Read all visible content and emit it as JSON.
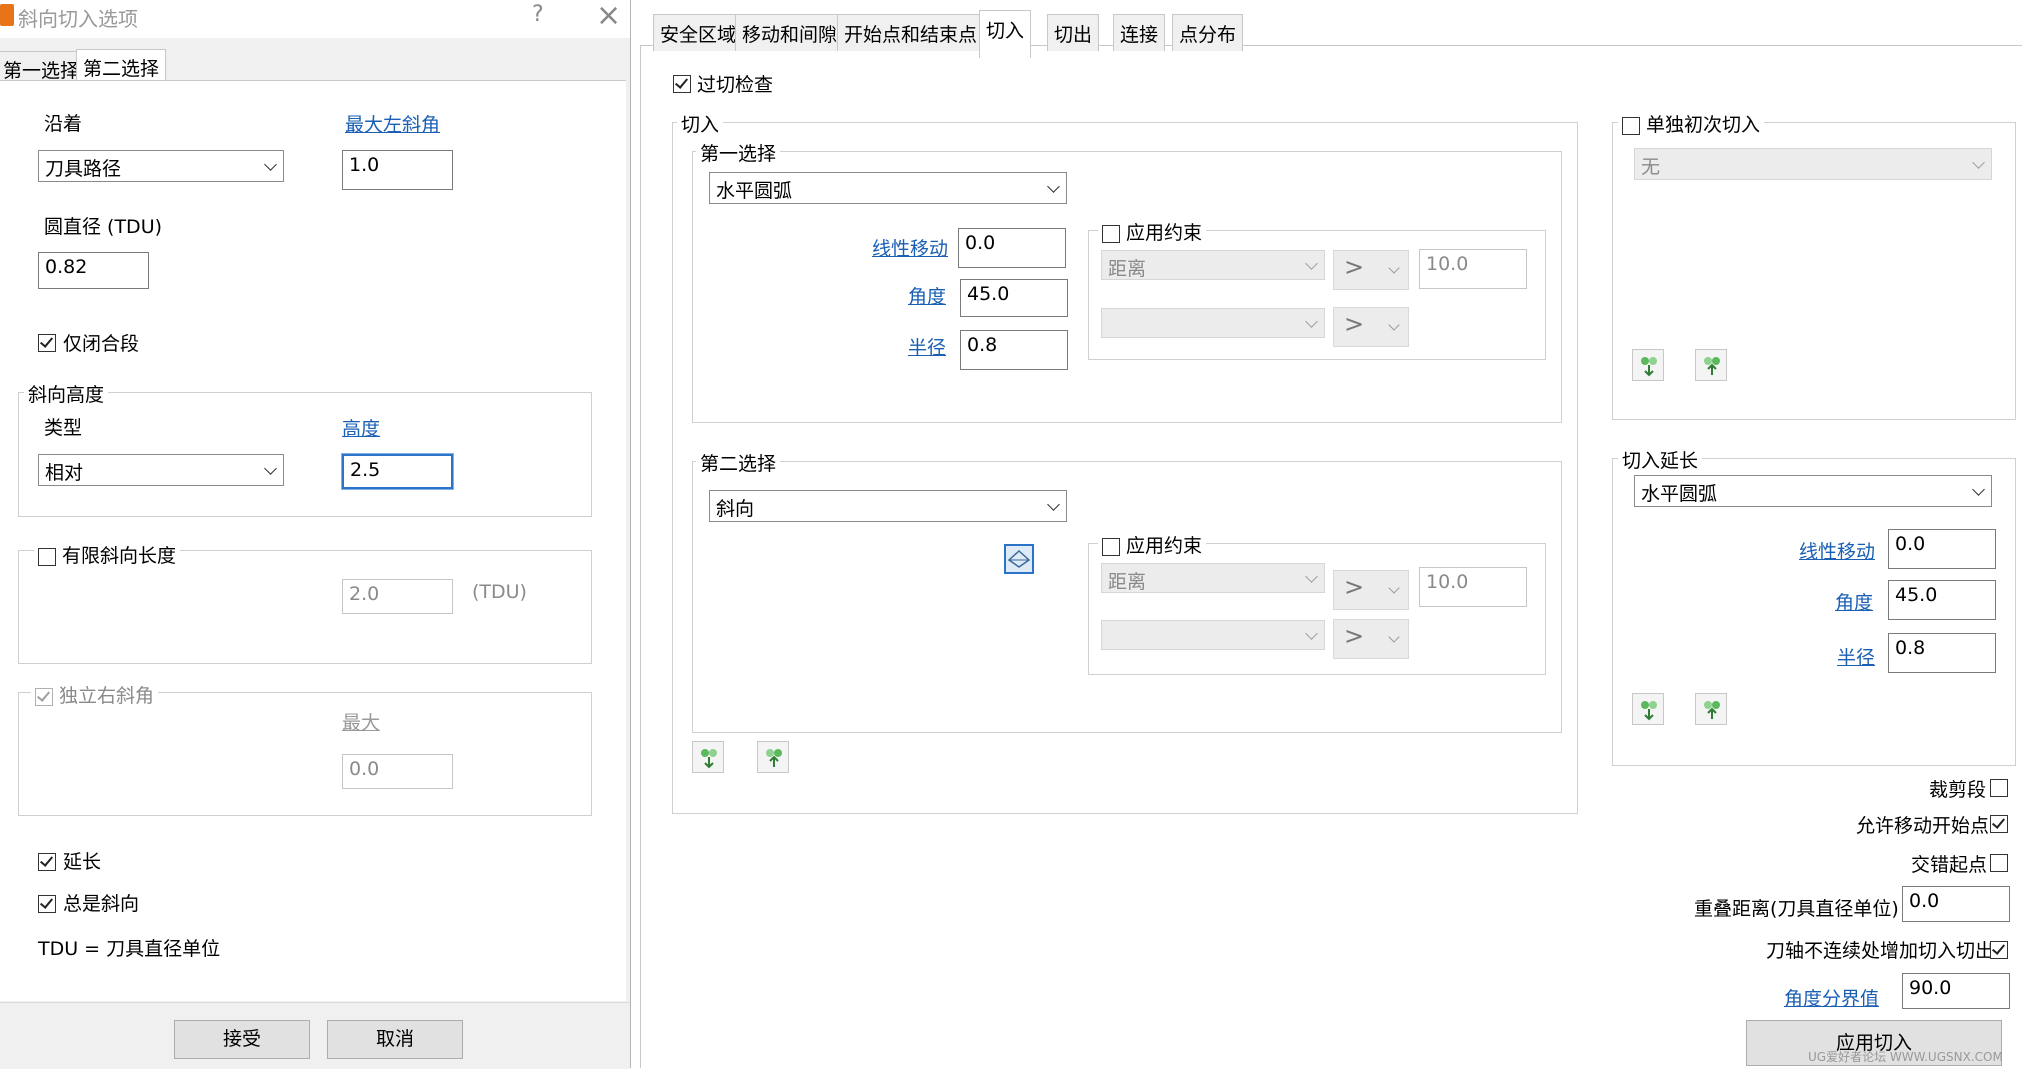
{
  "dialog": {
    "title": "斜向切入选项",
    "help": "?",
    "close": "×",
    "tabs": [
      {
        "label": "第一选择"
      },
      {
        "label": "第二选择"
      }
    ],
    "along_label": "沿着",
    "along_value": "刀具路径",
    "max_left_ramp_label": "最大左斜角",
    "max_left_ramp_value": "1.0",
    "circle_diameter_label": "圆直径 (TDU)",
    "circle_diameter_value": "0.82",
    "closed_only_label": "仅闭合段",
    "closed_only_checked": true,
    "ramp_height": {
      "title": "斜向高度",
      "type_label": "类型",
      "type_value": "相对",
      "height_label": "高度",
      "height_value": "2.5"
    },
    "finite_length": {
      "label": "有限斜向长度",
      "checked": false,
      "value": "2.0",
      "unit": "(TDU)"
    },
    "independent_right": {
      "label": "独立右斜角",
      "checked": true,
      "max_label": "最大",
      "max_value": "0.0"
    },
    "extend_label": "延长",
    "extend_checked": true,
    "always_ramp_label": "总是斜向",
    "always_ramp_checked": true,
    "tdu_note": "TDU = 刀具直径单位",
    "accept_label": "接受",
    "cancel_label": "取消"
  },
  "panel": {
    "tabs": [
      {
        "label": "安全区域"
      },
      {
        "label": "移动和间隙"
      },
      {
        "label": "开始点和结束点"
      },
      {
        "label": "切入"
      },
      {
        "label": "切出"
      },
      {
        "label": "连接"
      },
      {
        "label": "点分布"
      }
    ],
    "gouge_check_label": "过切检查",
    "gouge_check_checked": true,
    "lead_in": {
      "title": "切入",
      "first_choice": {
        "title": "第一选择",
        "type": "水平圆弧",
        "linear_move_label": "线性移动",
        "linear_move_value": "0.0",
        "angle_label": "角度",
        "angle_value": "45.0",
        "radius_label": "半径",
        "radius_value": "0.8",
        "apply_constraint_label": "应用约束",
        "constraint_type": "距离",
        "constraint_op": ">",
        "constraint_value": "10.0"
      },
      "second_choice": {
        "title": "第二选择",
        "type": "斜向",
        "apply_constraint_label": "应用约束",
        "constraint_type": "距离",
        "constraint_op": ">",
        "constraint_value": "10.0"
      }
    },
    "separate_first": {
      "label": "单独初次切入",
      "checked": false,
      "value": "无"
    },
    "lead_in_extension": {
      "title": "切入延长",
      "type": "水平圆弧",
      "linear_move_label": "线性移动",
      "linear_move_value": "0.0",
      "angle_label": "角度",
      "angle_value": "45.0",
      "radius_label": "半径",
      "radius_value": "0.8"
    },
    "trim_segment_label": "裁剪段",
    "trim_segment_checked": false,
    "allow_move_start_label": "允许移动开始点",
    "allow_move_start_checked": true,
    "stagger_start_label": "交错起点",
    "stagger_start_checked": false,
    "overlap_distance_label": "重叠距离(刀具直径单位)",
    "overlap_distance_value": "0.0",
    "axis_discontinuity_label": "刀轴不连续处增加切入切出",
    "axis_discontinuity_checked": true,
    "angle_threshold_label": "角度分界值",
    "angle_threshold_value": "90.0",
    "apply_label": "应用切入"
  },
  "watermark": "UG爱好者论坛 WWW.UGSNX.COM"
}
